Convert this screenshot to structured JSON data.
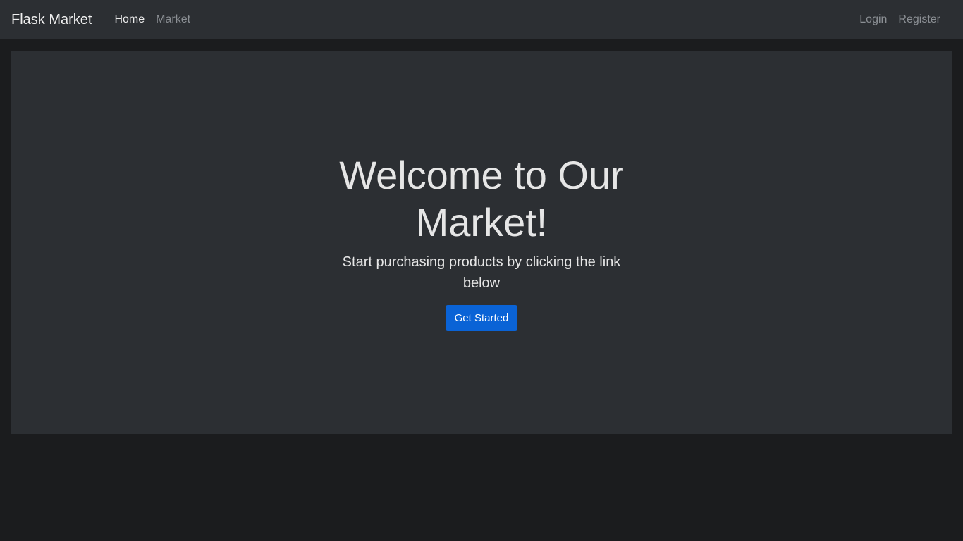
{
  "navbar": {
    "brand": "Flask Market",
    "left_links": [
      {
        "label": "Home",
        "active": true
      },
      {
        "label": "Market",
        "active": false
      }
    ],
    "right_links": [
      {
        "label": "Login"
      },
      {
        "label": "Register"
      }
    ]
  },
  "hero": {
    "title": "Welcome to Our Market!",
    "subtitle": "Start purchasing products by clicking the link below",
    "cta_label": "Get Started"
  },
  "colors": {
    "page_background": "#1b1c1e",
    "panel_background": "#2c2f33",
    "accent": "#0a63d6"
  }
}
